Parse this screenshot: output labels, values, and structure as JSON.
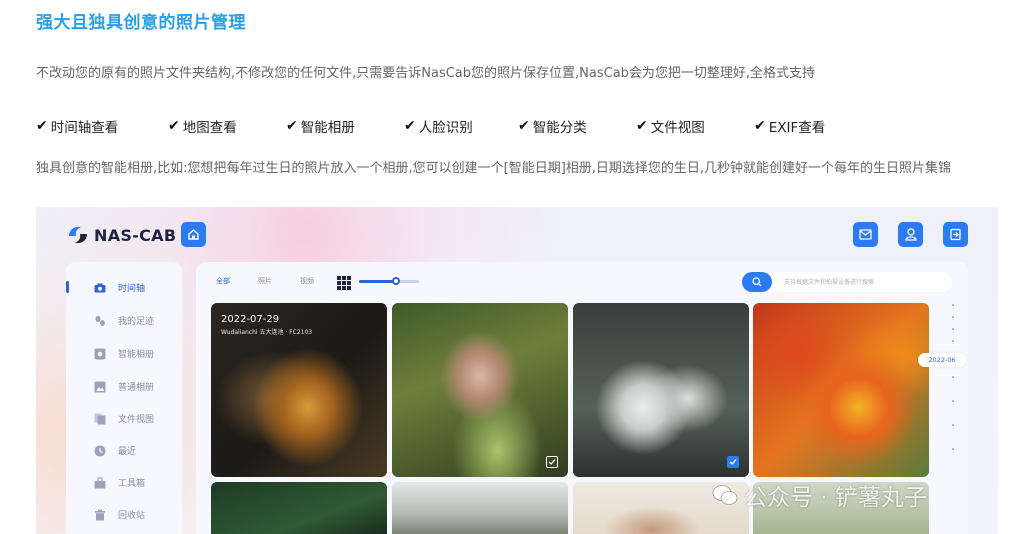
{
  "heading": "强大且独具创意的照片管理",
  "intro": "不改动您的原有的照片文件夹结构,不修改您的任何文件,只需要告诉NasCab您的照片保存位置,NasCab会为您把一切整理好,全格式支持",
  "features": [
    "时间轴查看",
    "地图查看",
    "智能相册",
    "人脸识别",
    "智能分类",
    "文件视图",
    "EXIF查看"
  ],
  "description": "独具创意的智能相册,比如:您想把每年过生日的照片放入一个相册,您可以创建一个[智能日期]相册,日期选择您的生日,几秒钟就能创建好一个每年的生日照片集锦",
  "app": {
    "logo_text": "NAS-CAB",
    "sidebar": [
      {
        "label": "时间轴",
        "icon": "camera-icon"
      },
      {
        "label": "我的足迹",
        "icon": "footprints-icon"
      },
      {
        "label": "智能相册",
        "icon": "smart-album-icon"
      },
      {
        "label": "普通相册",
        "icon": "album-icon"
      },
      {
        "label": "文件视图",
        "icon": "files-icon"
      },
      {
        "label": "最近",
        "icon": "clock-icon"
      },
      {
        "label": "工具箱",
        "icon": "toolbox-icon"
      },
      {
        "label": "回收站",
        "icon": "trash-icon"
      }
    ],
    "tabs": [
      "全部",
      "照片",
      "视频"
    ],
    "search_placeholder": "支持根据文件和拍摄设备进行搜索",
    "photo1_date": "2022-07-29",
    "photo1_place": "Wudalianchi 五大连池 · FC2103",
    "timeline_label": "2022-06",
    "zoom_level": 0.62,
    "accent_color": "#2d7bf2"
  },
  "watermark": "公众号 · 铲薯丸子"
}
